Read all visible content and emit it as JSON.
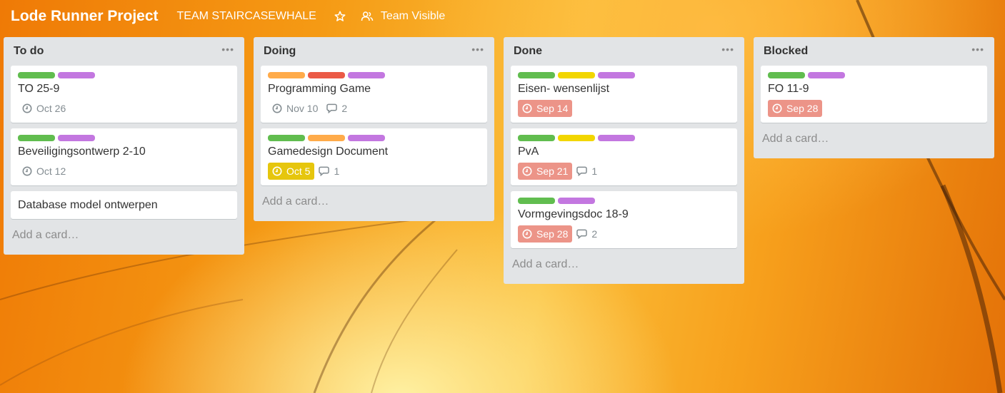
{
  "board": {
    "title": "Lode Runner Project",
    "team": "TEAM STAIRCASEWHALE",
    "visibility": "Team Visible"
  },
  "colors": {
    "green": "#61bd4f",
    "purple": "#c377e0",
    "orange": "#ffab4a",
    "red": "#eb5a46",
    "yellow": "#f2d600",
    "overdue": "#ec9488",
    "due_soon": "#e6c60d"
  },
  "add_card_label": "Add a card…",
  "lists": [
    {
      "title": "To do",
      "cards": [
        {
          "title": "TO 25-9",
          "due": "Oct 26"
        },
        {
          "title": "Beveiligingsontwerp 2-10",
          "due": "Oct 12"
        },
        {
          "title": "Database model ontwerpen"
        }
      ]
    },
    {
      "title": "Doing",
      "cards": [
        {
          "title": "Programming Game",
          "due": "Nov 10",
          "comments": "2"
        },
        {
          "title": "Gamedesign Document",
          "due": "Oct 5",
          "comments": "1"
        }
      ]
    },
    {
      "title": "Done",
      "cards": [
        {
          "title": "Eisen- wensenlijst",
          "due": "Sep 14"
        },
        {
          "title": "PvA",
          "due": "Sep 21",
          "comments": "1"
        },
        {
          "title": "Vormgevingsdoc 18-9",
          "due": "Sep 28",
          "comments": "2"
        }
      ]
    },
    {
      "title": "Blocked",
      "cards": [
        {
          "title": "FO 11-9",
          "due": "Sep 28"
        }
      ]
    }
  ]
}
